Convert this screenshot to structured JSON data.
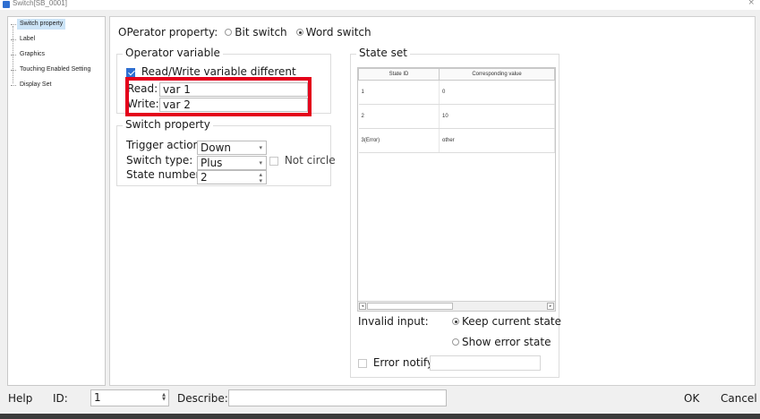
{
  "window": {
    "title": "Switch[SB_0001]",
    "close_glyph": "×"
  },
  "tree": {
    "items": [
      {
        "label": "Switch property",
        "selected": true
      },
      {
        "label": "Label",
        "selected": false
      },
      {
        "label": "Graphics",
        "selected": false
      },
      {
        "label": "Touching Enabled Setting",
        "selected": false
      },
      {
        "label": "Display Set",
        "selected": false
      }
    ]
  },
  "operator": {
    "label": "OPerator property:",
    "options": [
      "Bit switch",
      "Word switch"
    ],
    "selected": "Word switch"
  },
  "operator_variable": {
    "title": "Operator variable",
    "rw_different_label": "Read/Write variable different",
    "rw_different_checked": true,
    "read_label": "Read:",
    "read_value": "var 1",
    "write_label": "Write:",
    "write_value": "var 2"
  },
  "switch_property": {
    "title": "Switch property",
    "trigger_label": "Trigger action",
    "trigger_value": "Down",
    "type_label": "Switch type:",
    "type_value": "Plus",
    "not_circle_label": "Not circle",
    "not_circle_checked": false,
    "state_number_label": "State number",
    "state_number_value": "2"
  },
  "state_set": {
    "title": "State set",
    "columns": [
      "State ID",
      "Corresponding value"
    ],
    "rows": [
      [
        "1",
        "0"
      ],
      [
        "2",
        "10"
      ],
      [
        "3(Error)",
        "other"
      ]
    ],
    "invalid_input_label": "Invalid input:",
    "keep_label": "Keep current state",
    "show_error_label": "Show error state",
    "invalid_selected": "Keep current state",
    "error_notify_label": "Error notify",
    "error_notify_checked": false
  },
  "bottom": {
    "help_label": "Help",
    "id_label": "ID:",
    "id_value": "1",
    "describe_label": "Describe:",
    "describe_value": "",
    "ok_label": "OK",
    "cancel_label": "Cancel"
  },
  "colors": {
    "highlight": "#e4001b",
    "accent": "#2f6fd1",
    "selection": "#cce4f7"
  }
}
